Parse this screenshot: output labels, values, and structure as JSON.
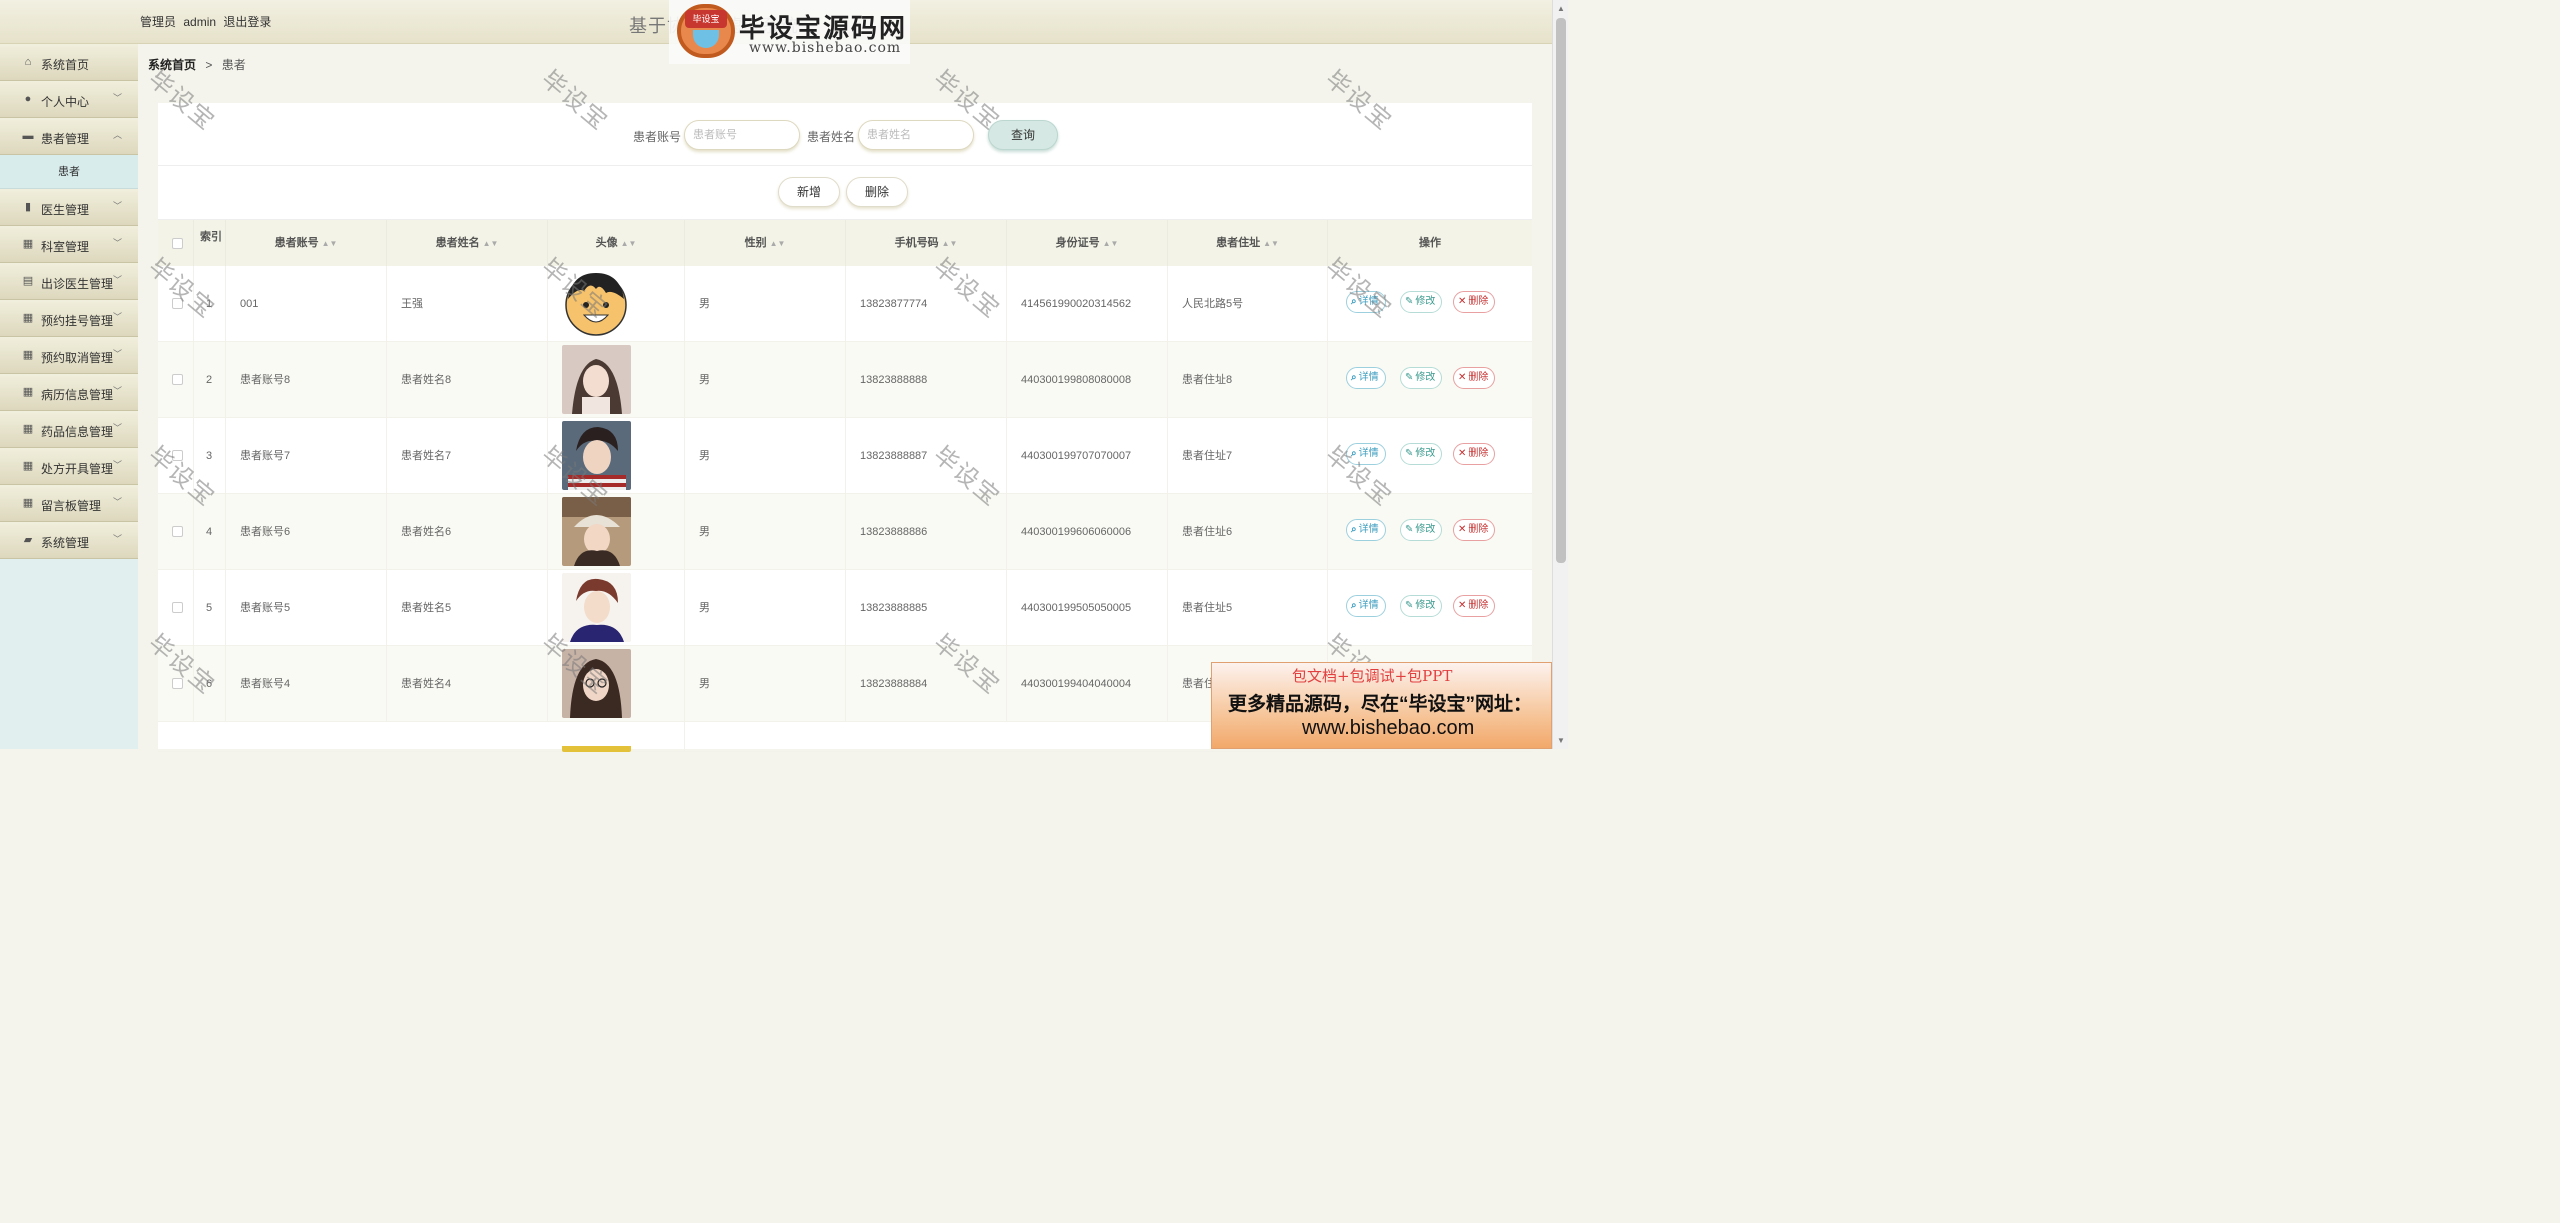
{
  "header": {
    "role": "管理员",
    "username": "admin",
    "logout_label": "退出登录",
    "system_title": "基于协同过滤...系统",
    "logo": {
      "badge": "毕设宝",
      "name": "毕设宝源码网",
      "url": "www.bishebao.com"
    }
  },
  "sidebar": {
    "items": [
      {
        "label": "系统首页",
        "icon": "home-icon",
        "expanded": false,
        "has_arrow": false
      },
      {
        "label": "个人中心",
        "icon": "user-icon",
        "expanded": false,
        "has_arrow": true
      },
      {
        "label": "患者管理",
        "icon": "bed-icon",
        "expanded": true,
        "has_arrow": true
      },
      {
        "label": "医生管理",
        "icon": "book-icon",
        "expanded": false,
        "has_arrow": true
      },
      {
        "label": "科室管理",
        "icon": "grid-icon",
        "expanded": false,
        "has_arrow": true
      },
      {
        "label": "出诊医生管理",
        "icon": "clipboard-icon",
        "expanded": false,
        "has_arrow": true
      },
      {
        "label": "预约挂号管理",
        "icon": "grid-icon",
        "expanded": false,
        "has_arrow": true
      },
      {
        "label": "预约取消管理",
        "icon": "grid-icon",
        "expanded": false,
        "has_arrow": true
      },
      {
        "label": "病历信息管理",
        "icon": "grid-icon",
        "expanded": false,
        "has_arrow": true
      },
      {
        "label": "药品信息管理",
        "icon": "grid-icon",
        "expanded": false,
        "has_arrow": true
      },
      {
        "label": "处方开具管理",
        "icon": "grid-icon",
        "expanded": false,
        "has_arrow": true
      },
      {
        "label": "留言板管理",
        "icon": "grid-icon",
        "expanded": false,
        "has_arrow": true
      },
      {
        "label": "系统管理",
        "icon": "briefcase-icon",
        "expanded": false,
        "has_arrow": true
      }
    ],
    "submenu": {
      "label": "患者"
    }
  },
  "breadcrumb": {
    "home": "系统首页",
    "separator": ">",
    "current": "患者"
  },
  "search": {
    "account_label": "患者账号",
    "account_placeholder": "患者账号",
    "name_label": "患者姓名",
    "name_placeholder": "患者姓名",
    "query_label": "查询"
  },
  "actions": {
    "add_label": "新增",
    "delete_label": "删除"
  },
  "table": {
    "headers": {
      "index": "索引",
      "account": "患者账号",
      "name": "患者姓名",
      "avatar": "头像",
      "gender": "性别",
      "phone": "手机号码",
      "id_card": "身份证号",
      "address": "患者住址",
      "ops": "操作"
    },
    "op_labels": {
      "detail": "详情",
      "edit": "修改",
      "delete": "删除"
    },
    "rows": [
      {
        "index": "1",
        "account": "001",
        "name": "王强",
        "gender": "男",
        "phone": "13823877774",
        "id_card": "414561990020314562",
        "address": "人民北路5号"
      },
      {
        "index": "2",
        "account": "患者账号8",
        "name": "患者姓名8",
        "gender": "男",
        "phone": "13823888888",
        "id_card": "440300199808080008",
        "address": "患者住址8"
      },
      {
        "index": "3",
        "account": "患者账号7",
        "name": "患者姓名7",
        "gender": "男",
        "phone": "13823888887",
        "id_card": "440300199707070007",
        "address": "患者住址7"
      },
      {
        "index": "4",
        "account": "患者账号6",
        "name": "患者姓名6",
        "gender": "男",
        "phone": "13823888886",
        "id_card": "440300199606060006",
        "address": "患者住址6"
      },
      {
        "index": "5",
        "account": "患者账号5",
        "name": "患者姓名5",
        "gender": "男",
        "phone": "13823888885",
        "id_card": "440300199505050005",
        "address": "患者住址5"
      },
      {
        "index": "6",
        "account": "患者账号4",
        "name": "患者姓名4",
        "gender": "男",
        "phone": "13823888884",
        "id_card": "440300199404040004",
        "address": "患者住"
      }
    ]
  },
  "watermark": {
    "text": "毕设宝"
  },
  "ad": {
    "line1": "包文档+包调试+包PPT",
    "line2": "更多精品源码，尽在“毕设宝”网址：",
    "line3": "www.bishebao.com"
  },
  "colors": {
    "header_bg": "#ebe7d2",
    "sidebar_bg": "#e1efef",
    "accent_teal": "#d5e8e3",
    "danger": "#c63030"
  }
}
